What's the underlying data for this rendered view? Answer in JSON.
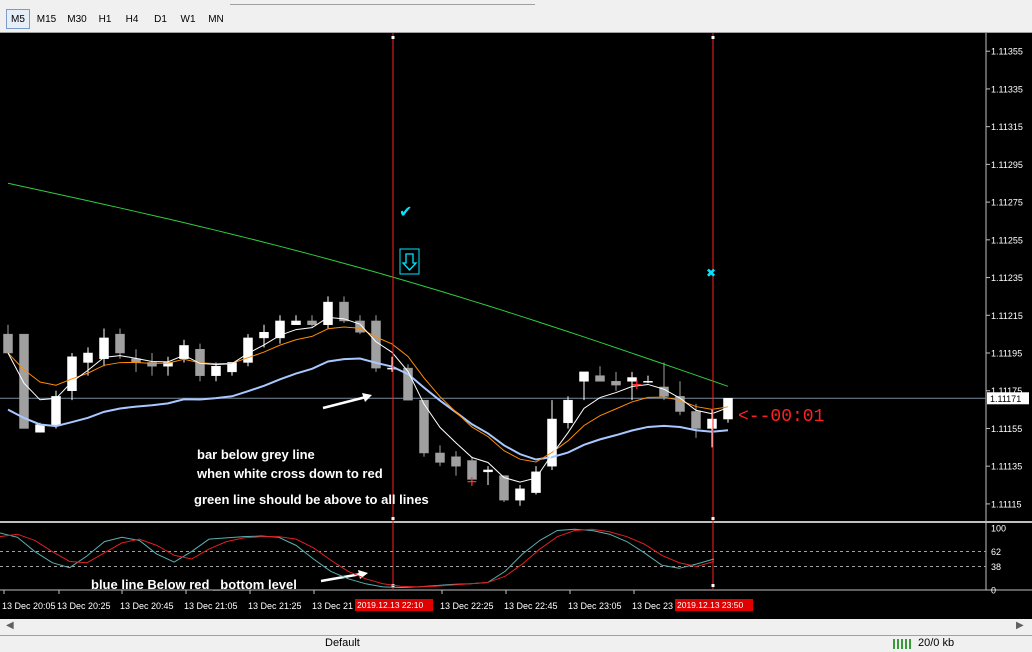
{
  "timeframes": [
    {
      "label": "M5",
      "active": true
    },
    {
      "label": "M15",
      "active": false
    },
    {
      "label": "M30",
      "active": false
    },
    {
      "label": "H1",
      "active": false
    },
    {
      "label": "H4",
      "active": false
    },
    {
      "label": "D1",
      "active": false
    },
    {
      "label": "W1",
      "active": false
    },
    {
      "label": "MN",
      "active": false
    }
  ],
  "price_axis": [
    "1.11355",
    "1.11335",
    "1.11315",
    "1.11295",
    "1.11275",
    "1.11255",
    "1.11235",
    "1.11215",
    "1.11195",
    "1.11175",
    "1.11155",
    "1.11135",
    "1.11115"
  ],
  "current_price": "1.11171",
  "osc_axis": [
    "100",
    "62",
    "38",
    "0"
  ],
  "time_axis": [
    "13 Dec 20:05",
    "13 Dec 20:25",
    "13 Dec 20:45",
    "13 Dec 21:05",
    "13 Dec 21:25",
    "13 Dec 21",
    "13 Dec 22:25",
    "13 Dec 22:45",
    "13 Dec 23:05",
    "13 Dec 23"
  ],
  "vline_labels": [
    "2019.12.13 22:10",
    "2019.12.13 23:50"
  ],
  "countdown": "<--00:01",
  "annotations": {
    "line1": "bar below grey line",
    "line2": "when white cross down to red",
    "line3": "green line should be above to all lines",
    "line4": "blue line Below red _bottom level"
  },
  "status": {
    "profile": "Default",
    "traffic": "20/0 kb"
  },
  "colors": {
    "background": "#000000",
    "green_ma": "#2ecc40",
    "orange_ma": "#ff8c00",
    "white_ma": "#ffffff",
    "blue_ma": "#a8c8ff",
    "vline": "#ff2020",
    "cyan": "#00e5ff"
  },
  "chart_data": {
    "type": "candlestick",
    "ylim": [
      1.11107,
      1.11362
    ],
    "candles": [
      [
        1.11205,
        1.1121,
        1.11195,
        1.11195
      ],
      [
        1.11205,
        1.11205,
        1.11155,
        1.11155
      ],
      [
        1.11153,
        1.11158,
        1.11153,
        1.11157
      ],
      [
        1.11157,
        1.11175,
        1.11155,
        1.11172
      ],
      [
        1.11175,
        1.11195,
        1.1117,
        1.11193
      ],
      [
        1.1119,
        1.11198,
        1.11183,
        1.11195
      ],
      [
        1.11192,
        1.11208,
        1.11188,
        1.11203
      ],
      [
        1.11205,
        1.11208,
        1.11192,
        1.11195
      ],
      [
        1.11192,
        1.11197,
        1.11185,
        1.1119
      ],
      [
        1.1119,
        1.11195,
        1.11183,
        1.11188
      ],
      [
        1.11188,
        1.11193,
        1.11183,
        1.1119
      ],
      [
        1.11192,
        1.11202,
        1.1119,
        1.11199
      ],
      [
        1.11197,
        1.112,
        1.1118,
        1.11183
      ],
      [
        1.11183,
        1.1119,
        1.1118,
        1.11188
      ],
      [
        1.11185,
        1.1119,
        1.11183,
        1.1119
      ],
      [
        1.1119,
        1.11205,
        1.11188,
        1.11203
      ],
      [
        1.11203,
        1.1121,
        1.11198,
        1.11206
      ],
      [
        1.11203,
        1.11215,
        1.112,
        1.11212
      ],
      [
        1.1121,
        1.11215,
        1.1121,
        1.11212
      ],
      [
        1.11212,
        1.11215,
        1.11209,
        1.1121
      ],
      [
        1.1121,
        1.11225,
        1.11208,
        1.11222
      ],
      [
        1.11222,
        1.11225,
        1.11211,
        1.11212
      ],
      [
        1.11212,
        1.11215,
        1.11205,
        1.11206
      ],
      [
        1.11212,
        1.11215,
        1.11185,
        1.11187
      ],
      [
        1.11187,
        1.11193,
        1.11185,
        1.11187
      ],
      [
        1.11187,
        1.11189,
        1.1117,
        1.1117
      ],
      [
        1.1117,
        1.1117,
        1.1114,
        1.11142
      ],
      [
        1.11142,
        1.11146,
        1.11135,
        1.11137
      ],
      [
        1.1114,
        1.11143,
        1.1113,
        1.11135
      ],
      [
        1.11138,
        1.1114,
        1.11125,
        1.11128
      ],
      [
        1.11132,
        1.11135,
        1.11125,
        1.11133
      ],
      [
        1.1113,
        1.1113,
        1.11116,
        1.11117
      ],
      [
        1.11117,
        1.11125,
        1.11114,
        1.11123
      ],
      [
        1.11121,
        1.11135,
        1.1112,
        1.11132
      ],
      [
        1.11135,
        1.1117,
        1.11133,
        1.1116
      ],
      [
        1.11158,
        1.11172,
        1.11155,
        1.1117
      ],
      [
        1.1118,
        1.11185,
        1.1117,
        1.11185
      ],
      [
        1.11183,
        1.11188,
        1.1118,
        1.1118
      ],
      [
        1.1118,
        1.11185,
        1.11175,
        1.11178
      ],
      [
        1.1118,
        1.11185,
        1.1117,
        1.11182
      ],
      [
        1.1118,
        1.11183,
        1.11179,
        1.1118
      ],
      [
        1.11177,
        1.1119,
        1.1117,
        1.11172
      ],
      [
        1.11172,
        1.1118,
        1.11162,
        1.11164
      ],
      [
        1.11164,
        1.11168,
        1.1115,
        1.11155
      ],
      [
        1.11155,
        1.11165,
        1.11145,
        1.1116
      ],
      [
        1.1116,
        1.11171,
        1.11158,
        1.11171
      ]
    ]
  }
}
